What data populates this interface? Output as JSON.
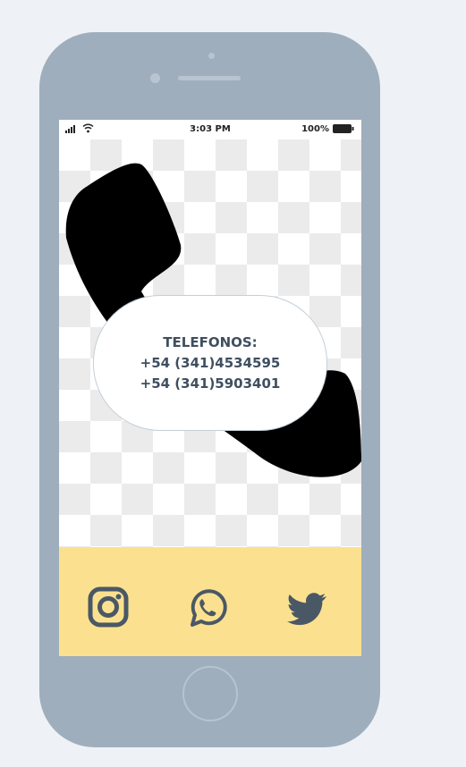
{
  "status_bar": {
    "time": "3:03 PM",
    "battery": "100%"
  },
  "contact": {
    "heading": "TELEFONOS:",
    "phones": [
      "+54 (341)4534595",
      "+54 (341)5903401"
    ]
  },
  "social": [
    {
      "name": "instagram",
      "icon": "instagram-icon"
    },
    {
      "name": "whatsapp",
      "icon": "whatsapp-icon"
    },
    {
      "name": "twitter",
      "icon": "twitter-icon"
    }
  ],
  "colors": {
    "frame": "#9eaebc",
    "bottom_bar": "#fbe18f",
    "text": "#3f4f60",
    "icons": "#4a5866"
  }
}
